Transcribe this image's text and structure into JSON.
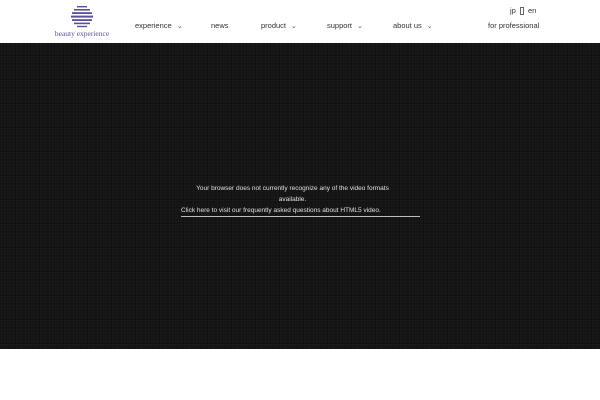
{
  "header": {
    "logo_text": "beauty experience",
    "brand_color": "#5a5096"
  },
  "nav": {
    "items": [
      {
        "label": "experience",
        "dropdown": true
      },
      {
        "label": "news",
        "dropdown": false
      },
      {
        "label": "product",
        "dropdown": true
      },
      {
        "label": "support",
        "dropdown": true
      },
      {
        "label": "about us",
        "dropdown": true
      }
    ],
    "chevron_icon": "chevron-down-icon",
    "chevron_glyph": "⌄"
  },
  "lang": {
    "jp": "jp",
    "en": "en"
  },
  "pro_link": "for professional",
  "video": {
    "fallback_line1": "Your browser does not currently recognize any of the video formats",
    "fallback_line2": "available.",
    "fallback_link": "Click here to visit our frequently asked questions about HTML5 video."
  }
}
